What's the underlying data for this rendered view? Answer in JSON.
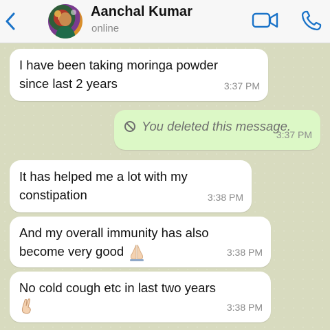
{
  "header": {
    "contact_name": "Aanchal Kumar",
    "status": "online",
    "back_icon": "chevron-left-icon",
    "video_icon": "video-camera-icon",
    "call_icon": "phone-icon",
    "accent_color": "#1a73c8"
  },
  "messages": [
    {
      "direction": "incoming",
      "text": "I have been taking moringa powder\nsince last 2 years",
      "time": "3:37 PM"
    },
    {
      "direction": "outgoing",
      "deleted": true,
      "text": "You deleted this message.",
      "time": "3:37 PM"
    },
    {
      "direction": "incoming",
      "text": "It has helped me a lot with my\nconstipation",
      "time": "3:38 PM"
    },
    {
      "direction": "incoming",
      "text": "And my overall immunity has also\nbecome very good",
      "emoji": "folded-hands",
      "time": "3:38 PM"
    },
    {
      "direction": "incoming",
      "text": "No cold cough etc in last two years",
      "emoji": "crossed-fingers",
      "time": "3:38 PM"
    }
  ]
}
